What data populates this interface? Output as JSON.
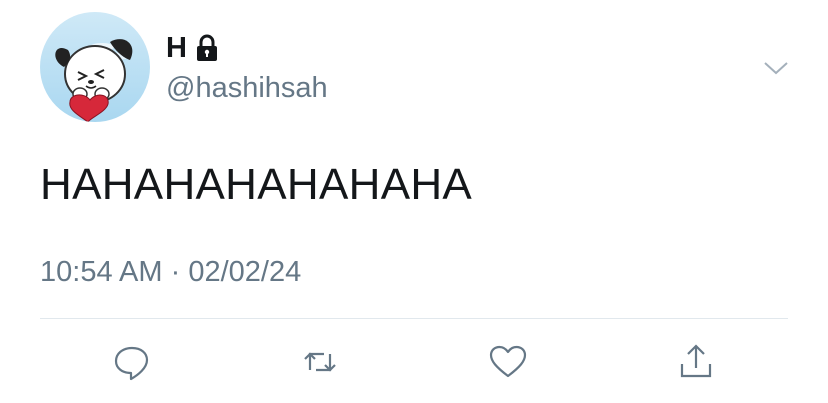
{
  "user": {
    "display_name": "H",
    "handle": "@hashihsah",
    "protected_icon": "lock-icon",
    "avatar_icon": "avatar-pochacco"
  },
  "tweet": {
    "text": "HAHAHAHAHAHAHA",
    "time": "10:54 AM",
    "separator": " · ",
    "date": "02/02/24"
  },
  "actions": [
    {
      "name": "reply",
      "icon": "reply-icon"
    },
    {
      "name": "retweet",
      "icon": "retweet-icon"
    },
    {
      "name": "like",
      "icon": "heart-icon"
    },
    {
      "name": "share",
      "icon": "share-icon"
    }
  ],
  "menu": {
    "icon": "chevron-down-icon"
  },
  "colors": {
    "text": "#14171a",
    "secondary": "#657786",
    "divider": "#e1e8ed"
  }
}
